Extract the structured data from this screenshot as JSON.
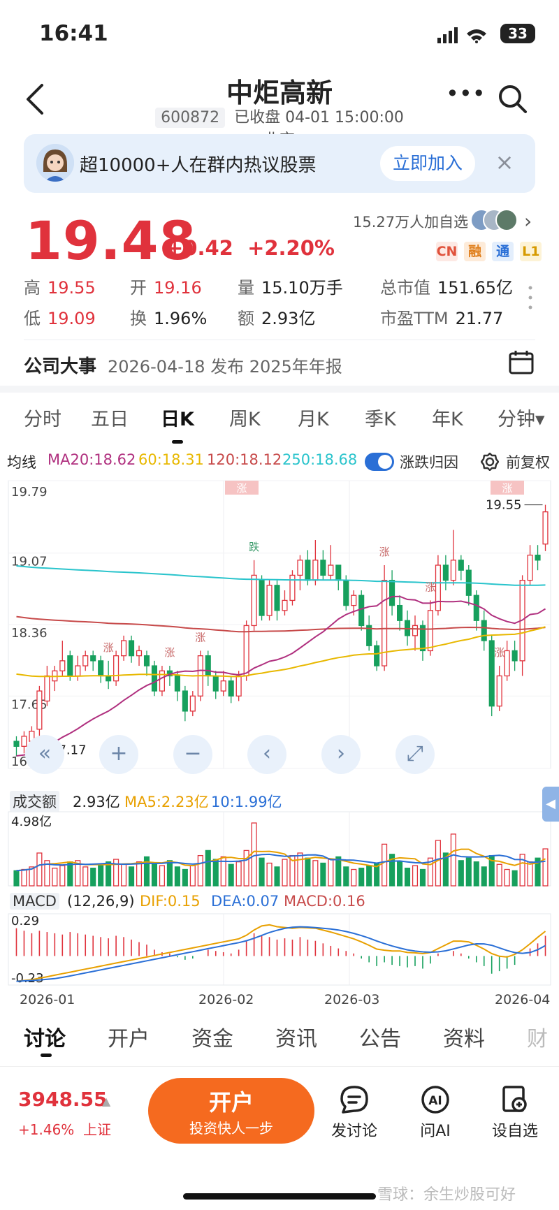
{
  "status_bar": {
    "time": "16:41",
    "battery": "33"
  },
  "nav": {
    "title": "中炬高新",
    "code": "600872",
    "status": "已收盘 04-01 15:00:00 北京"
  },
  "banner": {
    "text": "超10000+人在群内热议股票",
    "join": "立即加入"
  },
  "quote": {
    "price": "19.48",
    "change": "+0.42",
    "change_pct": "+2.20%",
    "followers": "15.27万人加自选",
    "tags": [
      "CN",
      "融",
      "通",
      "L1"
    ],
    "stats": {
      "high_label": "高",
      "high": "19.55",
      "open_label": "开",
      "open": "19.16",
      "volume_label": "量",
      "volume": "15.10万手",
      "mcap_label": "总市值",
      "mcap": "151.65亿",
      "low_label": "低",
      "low": "19.09",
      "turnover_label": "换",
      "turnover": "1.96%",
      "amount_label": "额",
      "amount": "2.93亿",
      "pe_label": "市盈TTM",
      "pe": "21.77"
    }
  },
  "events": {
    "label": "公司大事",
    "text": "2026-04-18 发布 2025年年报"
  },
  "kline_tabs": [
    "分时",
    "五日",
    "日K",
    "周K",
    "月K",
    "季K",
    "年K",
    "分钟▾"
  ],
  "kline_active": "日K",
  "ma": {
    "label": "均线",
    "ma20": "MA20:18.62",
    "ma60": "60:18.31",
    "ma120": "120:18.12",
    "ma250": "250:18.68",
    "toggle_label": "涨跌归因",
    "fq_label": "前复权"
  },
  "colors": {
    "up": "#e0323c",
    "down": "#16a05d",
    "ma20": "#b0307f",
    "ma60": "#e8b800",
    "ma120": "#c74a4a",
    "ma250": "#2ac4cc",
    "accent": "#2a6fd6",
    "orange": "#f56a1f"
  },
  "chart_data": [
    {
      "type": "candlestick",
      "title": "日K",
      "y_ticks": [
        "19.79",
        "19.07",
        "18.36",
        "17.65",
        "16.93"
      ],
      "ylim": [
        16.93,
        19.79
      ],
      "annotations": {
        "high": "19.55",
        "low": "17.17",
        "markers": [
          "涨",
          "涨",
          "涨",
          "跌",
          "涨",
          "涨",
          "涨"
        ]
      },
      "candles": [
        {
          "o": 17.2,
          "c": 17.15,
          "h": 17.25,
          "l": 17.05
        },
        {
          "o": 17.15,
          "c": 17.25,
          "h": 17.3,
          "l": 17.08
        },
        {
          "o": 17.2,
          "c": 17.3,
          "h": 17.35,
          "l": 17.1
        },
        {
          "o": 17.32,
          "c": 17.7,
          "h": 17.75,
          "l": 17.25
        },
        {
          "o": 17.6,
          "c": 17.85,
          "h": 17.95,
          "l": 17.55
        },
        {
          "o": 17.8,
          "c": 17.9,
          "h": 17.95,
          "l": 17.7
        },
        {
          "o": 17.9,
          "c": 18.0,
          "h": 18.2,
          "l": 17.85
        },
        {
          "o": 18.05,
          "c": 17.85,
          "h": 18.1,
          "l": 17.8
        },
        {
          "o": 17.85,
          "c": 17.95,
          "h": 18.05,
          "l": 17.8
        },
        {
          "o": 17.95,
          "c": 18.05,
          "h": 18.1,
          "l": 17.9
        },
        {
          "o": 18.05,
          "c": 18.0,
          "h": 18.1,
          "l": 17.9
        },
        {
          "o": 18.0,
          "c": 17.85,
          "h": 18.05,
          "l": 17.78
        },
        {
          "o": 17.85,
          "c": 17.8,
          "h": 18.0,
          "l": 17.72
        },
        {
          "o": 17.8,
          "c": 18.05,
          "h": 18.1,
          "l": 17.75
        },
        {
          "o": 18.05,
          "c": 18.2,
          "h": 18.25,
          "l": 18.0
        },
        {
          "o": 18.2,
          "c": 18.05,
          "h": 18.25,
          "l": 17.98
        },
        {
          "o": 18.05,
          "c": 18.1,
          "h": 18.15,
          "l": 17.95
        },
        {
          "o": 18.05,
          "c": 17.95,
          "h": 18.1,
          "l": 17.85
        },
        {
          "o": 17.95,
          "c": 17.7,
          "h": 18.0,
          "l": 17.65
        },
        {
          "o": 17.7,
          "c": 17.9,
          "h": 17.95,
          "l": 17.65
        },
        {
          "o": 17.9,
          "c": 17.85,
          "h": 17.95,
          "l": 17.75
        },
        {
          "o": 17.85,
          "c": 17.7,
          "h": 17.9,
          "l": 17.6
        },
        {
          "o": 17.7,
          "c": 17.5,
          "h": 17.75,
          "l": 17.4
        },
        {
          "o": 17.5,
          "c": 17.65,
          "h": 17.7,
          "l": 17.45
        },
        {
          "o": 17.65,
          "c": 18.05,
          "h": 18.1,
          "l": 17.6
        },
        {
          "o": 18.05,
          "c": 17.85,
          "h": 18.1,
          "l": 17.75
        },
        {
          "o": 17.85,
          "c": 17.7,
          "h": 17.9,
          "l": 17.62
        },
        {
          "o": 17.7,
          "c": 17.8,
          "h": 17.9,
          "l": 17.65
        },
        {
          "o": 17.8,
          "c": 17.65,
          "h": 17.85,
          "l": 17.58
        },
        {
          "o": 17.65,
          "c": 17.85,
          "h": 17.9,
          "l": 17.6
        },
        {
          "o": 17.85,
          "c": 18.35,
          "h": 18.4,
          "l": 17.8
        },
        {
          "o": 18.35,
          "c": 18.85,
          "h": 19.0,
          "l": 18.3
        },
        {
          "o": 18.8,
          "c": 18.45,
          "h": 18.85,
          "l": 18.4
        },
        {
          "o": 18.45,
          "c": 18.75,
          "h": 18.8,
          "l": 18.4
        },
        {
          "o": 18.75,
          "c": 18.5,
          "h": 18.8,
          "l": 18.4
        },
        {
          "o": 18.5,
          "c": 18.6,
          "h": 18.7,
          "l": 18.45
        },
        {
          "o": 18.6,
          "c": 18.85,
          "h": 18.9,
          "l": 18.55
        },
        {
          "o": 18.85,
          "c": 19.0,
          "h": 19.05,
          "l": 18.7
        },
        {
          "o": 19.0,
          "c": 18.8,
          "h": 19.1,
          "l": 18.75
        },
        {
          "o": 18.8,
          "c": 19.0,
          "h": 19.2,
          "l": 18.75
        },
        {
          "o": 19.0,
          "c": 18.85,
          "h": 19.1,
          "l": 18.8
        },
        {
          "o": 18.85,
          "c": 18.95,
          "h": 19.15,
          "l": 18.8
        },
        {
          "o": 18.95,
          "c": 18.8,
          "h": 18.95,
          "l": 18.7
        },
        {
          "o": 18.8,
          "c": 18.55,
          "h": 18.85,
          "l": 18.5
        },
        {
          "o": 18.55,
          "c": 18.65,
          "h": 18.7,
          "l": 18.45
        },
        {
          "o": 18.65,
          "c": 18.35,
          "h": 18.7,
          "l": 18.3
        },
        {
          "o": 18.35,
          "c": 18.15,
          "h": 18.45,
          "l": 18.1
        },
        {
          "o": 18.15,
          "c": 17.95,
          "h": 18.2,
          "l": 17.9
        },
        {
          "o": 17.95,
          "c": 18.8,
          "h": 18.95,
          "l": 17.9
        },
        {
          "o": 18.8,
          "c": 18.55,
          "h": 18.9,
          "l": 18.45
        },
        {
          "o": 18.55,
          "c": 18.4,
          "h": 18.65,
          "l": 18.3
        },
        {
          "o": 18.4,
          "c": 18.25,
          "h": 18.5,
          "l": 18.15
        },
        {
          "o": 18.25,
          "c": 18.35,
          "h": 18.45,
          "l": 18.1
        },
        {
          "o": 18.35,
          "c": 18.1,
          "h": 18.4,
          "l": 18.0
        },
        {
          "o": 18.1,
          "c": 18.5,
          "h": 18.6,
          "l": 18.05
        },
        {
          "o": 18.5,
          "c": 18.95,
          "h": 19.05,
          "l": 18.45
        },
        {
          "o": 18.95,
          "c": 18.8,
          "h": 19.05,
          "l": 18.7
        },
        {
          "o": 18.8,
          "c": 19.0,
          "h": 19.3,
          "l": 18.75
        },
        {
          "o": 19.0,
          "c": 18.9,
          "h": 19.05,
          "l": 18.8
        },
        {
          "o": 18.9,
          "c": 18.65,
          "h": 18.95,
          "l": 18.55
        },
        {
          "o": 18.65,
          "c": 18.4,
          "h": 18.7,
          "l": 18.3
        },
        {
          "o": 18.4,
          "c": 18.2,
          "h": 18.5,
          "l": 18.1
        },
        {
          "o": 18.2,
          "c": 17.55,
          "h": 18.25,
          "l": 17.45
        },
        {
          "o": 17.55,
          "c": 17.85,
          "h": 17.95,
          "l": 17.5
        },
        {
          "o": 17.85,
          "c": 18.1,
          "h": 18.2,
          "l": 17.8
        },
        {
          "o": 18.1,
          "c": 18.0,
          "h": 18.2,
          "l": 17.9
        },
        {
          "o": 18.0,
          "c": 18.8,
          "h": 18.85,
          "l": 17.85
        },
        {
          "o": 18.8,
          "c": 19.05,
          "h": 19.15,
          "l": 18.75
        },
        {
          "o": 19.05,
          "c": 19.0,
          "h": 19.15,
          "l": 18.9
        },
        {
          "o": 19.16,
          "c": 19.48,
          "h": 19.55,
          "l": 19.09
        }
      ]
    },
    {
      "type": "bar",
      "title": "成交额",
      "summary": {
        "label": "成交额",
        "value": "2.93亿",
        "ma5": "MA5:2.23亿",
        "ma10": "10:1.99亿",
        "max_tick": "4.98亿"
      },
      "values_yi": [
        1.2,
        1.3,
        1.5,
        2.6,
        2.0,
        1.4,
        1.6,
        1.9,
        2.0,
        1.5,
        1.4,
        1.6,
        1.9,
        2.1,
        1.7,
        1.5,
        1.9,
        2.3,
        1.8,
        1.6,
        2.0,
        1.5,
        1.3,
        1.6,
        2.4,
        2.8,
        2.1,
        2.3,
        1.7,
        1.9,
        2.8,
        4.98,
        2.2,
        1.8,
        1.5,
        2.1,
        2.4,
        2.6,
        2.2,
        2.0,
        1.8,
        2.1,
        2.3,
        1.5,
        1.3,
        1.4,
        1.6,
        1.8,
        3.3,
        2.5,
        1.9,
        1.4,
        1.6,
        1.3,
        2.2,
        3.6,
        2.6,
        4.1,
        2.0,
        2.2,
        1.9,
        1.5,
        2.4,
        1.7,
        1.3,
        1.2,
        2.5,
        1.9,
        2.2,
        2.93
      ]
    },
    {
      "type": "bar",
      "title": "MACD",
      "summary": {
        "label": "MACD",
        "params": "(12,26,9)",
        "dif": "DIF:0.15",
        "dea": "DEA:0.07",
        "macd": "MACD:0.16",
        "top_tick": "0.29",
        "bottom_tick": "-0.23"
      },
      "values": [
        0.22,
        0.2,
        0.18,
        0.2,
        0.19,
        0.18,
        0.17,
        0.19,
        0.18,
        0.17,
        0.16,
        0.15,
        0.14,
        0.16,
        0.15,
        0.13,
        0.11,
        0.09,
        0.05,
        0.03,
        0.02,
        -0.01,
        -0.03,
        -0.02,
        0.0,
        0.05,
        0.04,
        0.03,
        0.02,
        0.05,
        0.12,
        0.18,
        0.16,
        0.15,
        0.13,
        0.14,
        0.13,
        0.15,
        0.13,
        0.12,
        0.1,
        0.08,
        0.06,
        0.04,
        0.02,
        -0.02,
        -0.05,
        -0.08,
        -0.05,
        -0.07,
        -0.08,
        -0.09,
        -0.08,
        -0.1,
        -0.06,
        0.02,
        0.0,
        0.04,
        0.02,
        -0.02,
        -0.05,
        -0.08,
        -0.14,
        -0.12,
        -0.1,
        -0.07,
        0.0,
        0.06,
        0.1,
        0.16
      ]
    }
  ],
  "chart_dates": [
    "2026-01",
    "2026-02",
    "2026-03",
    "2026-04"
  ],
  "bottom_tabs": [
    "讨论",
    "开户",
    "资金",
    "资讯",
    "公告",
    "资料",
    "财"
  ],
  "bottom_tab_active": "讨论",
  "index": {
    "value": "3948.55",
    "change": "+1.46%",
    "name": "上证"
  },
  "open_btn": {
    "title": "开户",
    "sub": "投资快人一步"
  },
  "actions": {
    "discuss": "发讨论",
    "ai": "问AI",
    "watch": "设自选"
  },
  "watermark": "雪球：余生炒股可好"
}
